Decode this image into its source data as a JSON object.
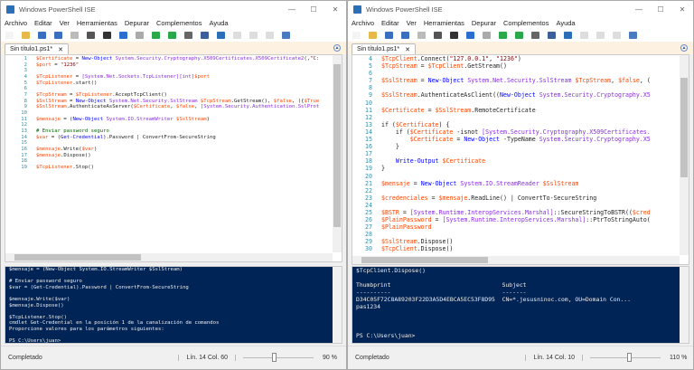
{
  "windows": [
    {
      "title": "Windows PowerShell ISE",
      "menu": [
        "Archivo",
        "Editar",
        "Ver",
        "Herramientas",
        "Depurar",
        "Complementos",
        "Ayuda"
      ],
      "tab": "Sin título1.ps1*",
      "first_line": 1,
      "code": [
        "$Certificate = New-Object System.Security.Cryptography.X509Certificates.X509Certificate2(,\"C:",
        "$port = \"1236\"",
        "",
        "$TcpListener = [System.Net.Sockets.TcpListener][int]$port",
        "$TcpListener.start()",
        "",
        "$TcpStream = $TcpListener.AcceptTcpClient()",
        "$SslStream = New-Object System.Net.Security.SslStream $TcpStream.GetStream(), $false, ({$True",
        "$SslStream.AuthenticateAsServer($Certificate, $false, [System.Security.Authentication.SslProt",
        "",
        "$mensaje = (New-Object System.IO.StreamWriter $SslStream)",
        "",
        "# Enviar password seguro",
        "$var = (Get-Credential).Password | ConvertFrom-SecureString",
        "",
        "$mensaje.Write($var)",
        "$mensaje.Dispose()",
        "",
        "$TcpListener.Stop()"
      ],
      "console": [
        "$mensaje = (New-Object System.IO.StreamWriter $SslStream)",
        "",
        "# Enviar password seguro",
        "$var = (Get-Credential).Password | ConvertFrom-SecureString",
        "",
        "$mensaje.Write($var)",
        "$mensaje.Dispose()",
        "",
        "$TcpListener.Stop()",
        "cmdlet Get-Credential en la posición 1 de la canalización de comandos",
        "Proporcione valores para los parámetros siguientes:",
        "",
        "PS C:\\Users\\juan>"
      ],
      "status": {
        "text": "Completado",
        "position": "Lín. 14  Col. 60",
        "zoom": "90 %",
        "zoom_value": 90
      }
    },
    {
      "title": "Windows PowerShell ISE",
      "menu": [
        "Archivo",
        "Editar",
        "Ver",
        "Herramientas",
        "Depurar",
        "Complementos",
        "Ayuda"
      ],
      "tab": "Sin título1.ps1*",
      "first_line": 4,
      "code": [
        "$TcpClient.Connect(\"127.0.0.1\", \"1236\")",
        "$TcpStream = $TcpClient.GetStream()",
        "",
        "$SslStream = New-Object System.Net.Security.SslStream $TcpStream, $false, (",
        "",
        "$SslStream.AuthenticateAsClient((New-Object System.Security.Cryptography.X5",
        "",
        "$Certificate = $SslStream.RemoteCertificate",
        "",
        "if ($Certificate) {",
        "    if ($Certificate -isnot [System.Security.Cryptography.X509Certificates.",
        "        $Certificate = New-Object -TypeName System.Security.Cryptography.X5",
        "    }",
        "",
        "    Write-Output $Certificate",
        "}",
        "",
        "$mensaje = New-Object System.IO.StreamReader $SslStream",
        "",
        "$credenciales = $mensaje.ReadLine() | ConvertTo-SecureString",
        "",
        "$BSTR = [System.Runtime.InteropServices.Marshal]::SecureStringToBSTR(($cred",
        "$PlainPassword = [System.Runtime.InteropServices.Marshal]::PtrToStringAuto(",
        "$PlainPassword",
        "",
        "$SslStream.Dispose()",
        "$TcpClient.Dispose()"
      ],
      "console": [
        "$TcpClient.Dispose()",
        "",
        "Thumbprint                                Subject",
        "----------                                -------",
        "D34C05F72C8A89203F22D3A5D4EBCA5EC53F8D95  CN=*.jesusninoc.com, OU=Domain Con...",
        "pas1234",
        "",
        "",
        "",
        "PS C:\\Users\\juan>"
      ],
      "status": {
        "text": "Completado",
        "position": "Lín. 14  Col. 10",
        "zoom": "110 %",
        "zoom_value": 110
      }
    }
  ],
  "toolbar_icons": [
    "new-icon",
    "open-icon",
    "save-icon",
    "cut-icon",
    "copy-icon",
    "paste-icon",
    "clear-icon",
    "undo-icon",
    "redo-icon",
    "run-icon",
    "run-selection-icon",
    "stop-icon",
    "remote-icon",
    "powershell-icon",
    "layout-top-icon",
    "layout-right-icon",
    "layout-max-icon",
    "addon-icon"
  ],
  "toolbar_colors": [
    "#f4f4f4",
    "#e8b84a",
    "#3a6fc0",
    "#3a6fc0",
    "#bbb",
    "#555",
    "#333",
    "#2a6fd0",
    "#aaa",
    "#2aa84a",
    "#2aa84a",
    "#666",
    "#3a5f9a",
    "#2a6fb8",
    "#ddd",
    "#ddd",
    "#ddd",
    "#4a7ac0"
  ]
}
